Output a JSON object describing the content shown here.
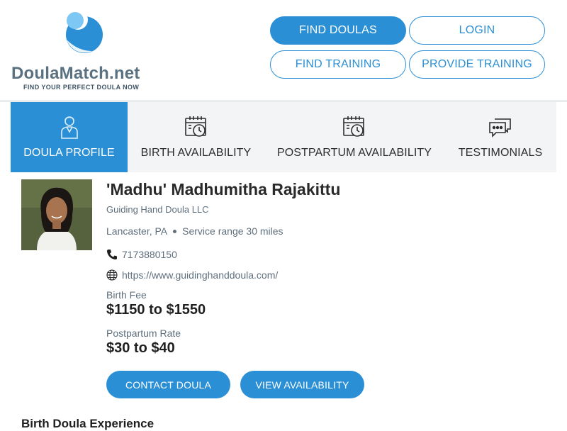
{
  "brand": {
    "name": "DoulaMatch.net",
    "tagline": "FIND YOUR PERFECT DOULA NOW",
    "colors": {
      "primary": "#2b8fd6",
      "logo_text": "#5a7182",
      "logo_light": "#7cc7f4"
    }
  },
  "header_nav": {
    "find_doulas": "FIND DOULAS",
    "login": "LOGIN",
    "find_training": "FIND TRAINING",
    "provide_training": "PROVIDE TRAINING"
  },
  "tabs": [
    {
      "label": "DOULA PROFILE",
      "icon": "doula-person-icon",
      "active": true
    },
    {
      "label": "BIRTH AVAILABILITY",
      "icon": "calendar-clock-icon",
      "active": false
    },
    {
      "label": "POSTPARTUM AVAILABILITY",
      "icon": "calendar-clock-icon",
      "active": false
    },
    {
      "label": "TESTIMONIALS",
      "icon": "chat-bubbles-icon",
      "active": false
    }
  ],
  "profile": {
    "name": "'Madhu' Madhumitha Rajakittu",
    "company": "Guiding Hand Doula LLC",
    "location": "Lancaster, PA",
    "service_range": "Service range 30 miles",
    "phone": "7173880150",
    "website": "https://www.guidinghanddoula.com/",
    "birth_fee_label": "Birth Fee",
    "birth_fee": "$1150 to $1550",
    "postpartum_label": "Postpartum Rate",
    "postpartum_rate": "$30 to $40"
  },
  "actions": {
    "contact": "CONTACT DOULA",
    "availability": "VIEW AVAILABILITY"
  },
  "section": {
    "heading": "Birth Doula Experience"
  }
}
